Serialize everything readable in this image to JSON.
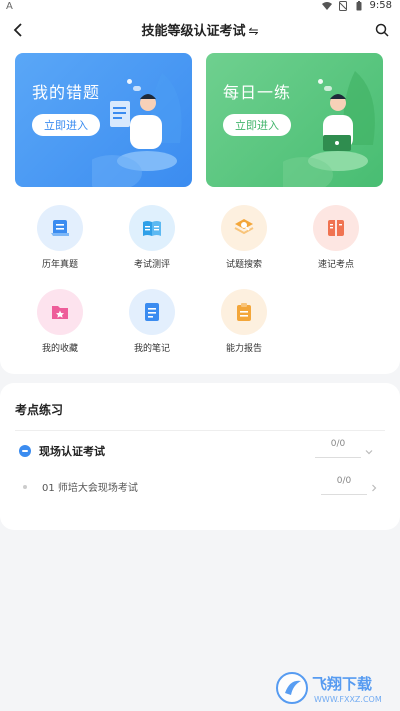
{
  "status_bar": {
    "left_icon": "A",
    "time": "9:58"
  },
  "header": {
    "title": "技能等级认证考试",
    "switch_glyph": "⇋"
  },
  "cards": [
    {
      "title": "我的错题",
      "button": "立即进入",
      "color": "#3b8cf0"
    },
    {
      "title": "每日一练",
      "button": "立即进入",
      "color": "#48bd72"
    }
  ],
  "grid": [
    {
      "label": "历年真题",
      "icon": "scroll-icon",
      "bg": "#e3effd",
      "fg": "#3b8cf0"
    },
    {
      "label": "考试测评",
      "icon": "book-icon",
      "bg": "#dff0fd",
      "fg": "#2fa0e8"
    },
    {
      "label": "试题搜索",
      "icon": "search-layers-icon",
      "bg": "#fdf0df",
      "fg": "#f3a63a"
    },
    {
      "label": "速记考点",
      "icon": "notebook-icon",
      "bg": "#fde6e2",
      "fg": "#f07351"
    },
    {
      "label": "我的收藏",
      "icon": "star-folder-icon",
      "bg": "#fde3ee",
      "fg": "#ee5d9a"
    },
    {
      "label": "我的笔记",
      "icon": "note-icon",
      "bg": "#e3effd",
      "fg": "#3b8cf0"
    },
    {
      "label": "能力报告",
      "icon": "clipboard-icon",
      "bg": "#fdf0df",
      "fg": "#f3a63a"
    }
  ],
  "practice": {
    "title": "考点练习",
    "group": {
      "label": "现场认证考试",
      "score": "0/0"
    },
    "item": {
      "label": "01 师培大会现场考试",
      "score": "0/0"
    }
  },
  "watermark": {
    "text": "飞翔下载",
    "url": "WWW.FXXZ.COM"
  }
}
